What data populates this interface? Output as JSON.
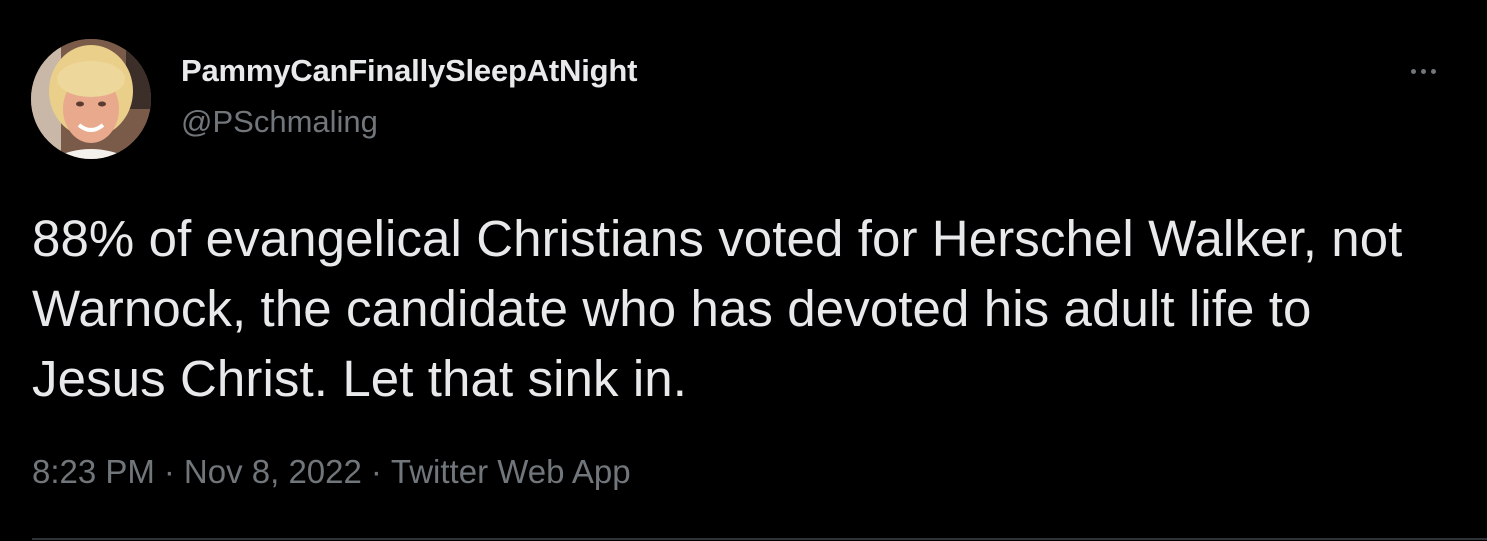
{
  "tweet": {
    "author": {
      "display_name": "PammyCanFinallySleepAtNight",
      "handle": "@PSchmaling"
    },
    "text": "88% of evangelical Christians voted for Herschel Walker, not Warnock, the candidate who has devoted his adult life to Jesus Christ. Let that sink in.",
    "meta": {
      "time": "8:23 PM",
      "separator": "·",
      "date": "Nov 8, 2022",
      "source": "Twitter Web App"
    },
    "more_icon": "more-horizontal-icon"
  },
  "colors": {
    "background": "#000000",
    "primary_text": "#e7e9ea",
    "secondary_text": "#71767b",
    "divider": "#2f3336"
  }
}
